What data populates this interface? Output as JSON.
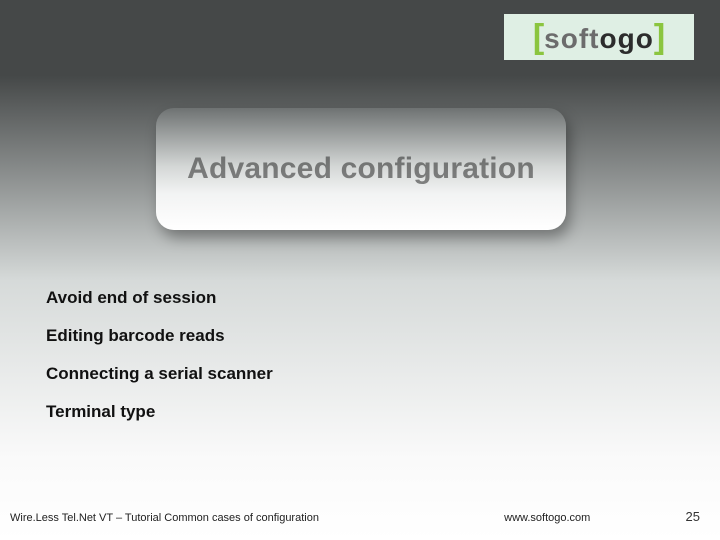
{
  "logo": {
    "bracket_open": "[",
    "part1": "soft",
    "part2": "ogo",
    "bracket_close": "]"
  },
  "title": "Advanced configuration",
  "bullets": {
    "items": [
      {
        "label": "Avoid end of session"
      },
      {
        "label": "Editing barcode reads"
      },
      {
        "label": "Connecting a serial scanner"
      },
      {
        "label": "Terminal type"
      }
    ]
  },
  "footer": {
    "left": "Wire.Less Tel.Net VT – Tutorial Common cases of configuration",
    "center": "www.softogo.com",
    "page": "25"
  }
}
